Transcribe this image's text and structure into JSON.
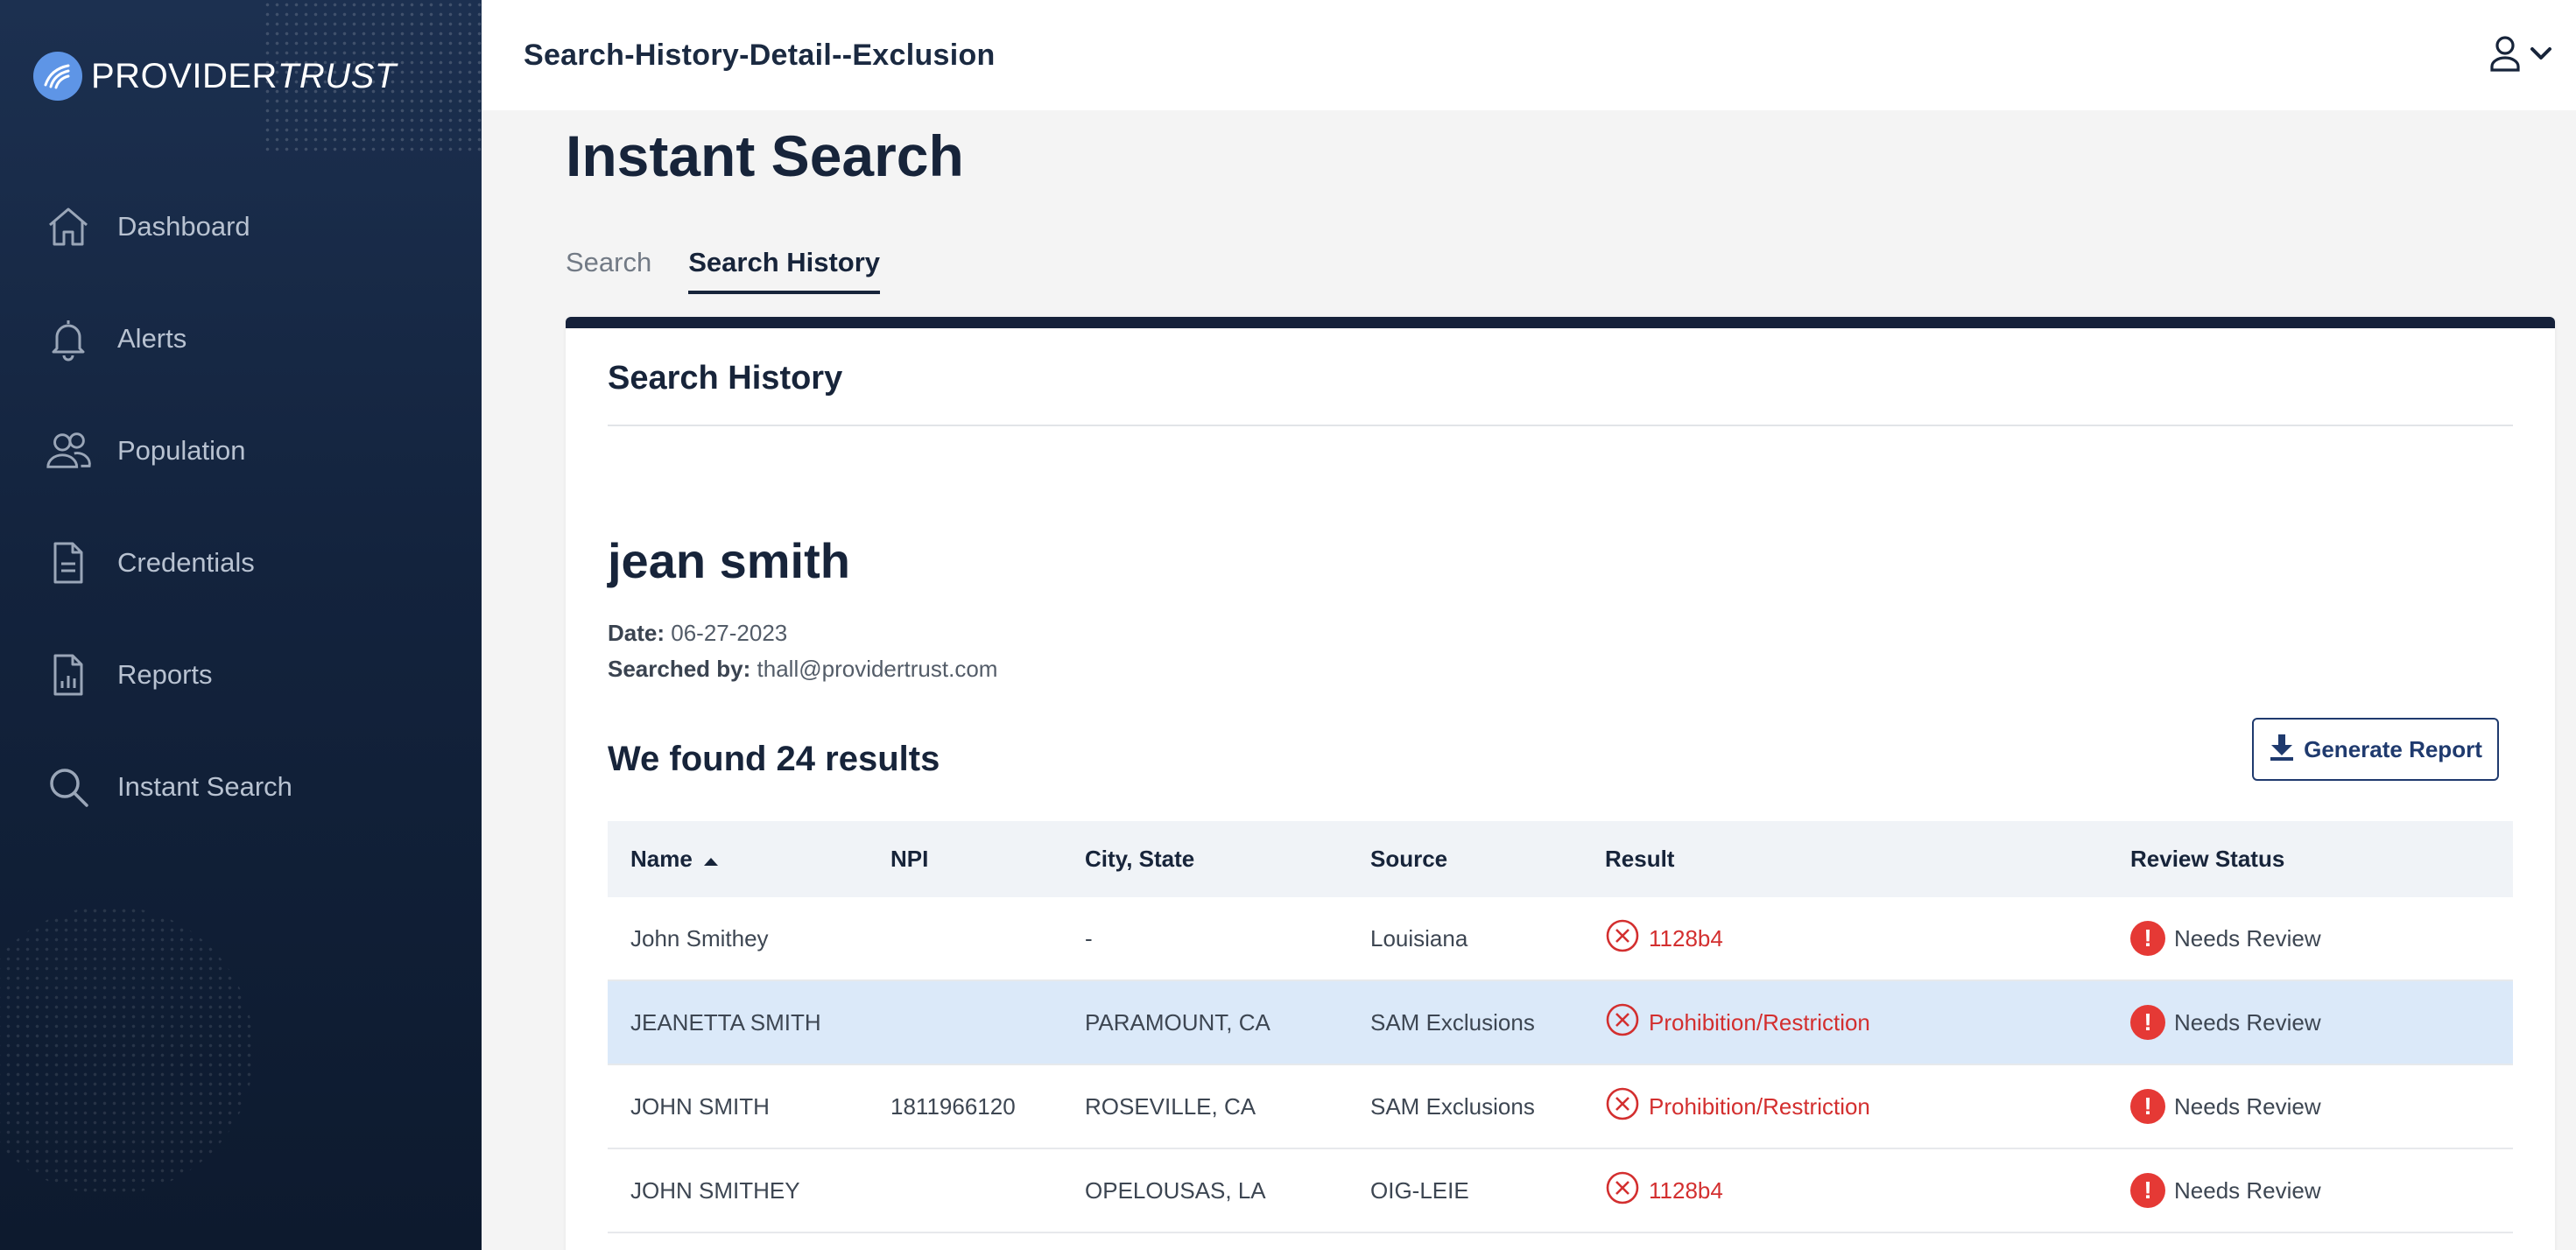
{
  "app": {
    "brand_primary": "PROVIDER",
    "brand_secondary": "TRUST",
    "window_title": "Search-History-Detail--Exclusion"
  },
  "sidebar": {
    "items": [
      {
        "label": "Dashboard",
        "icon": "home-icon"
      },
      {
        "label": "Alerts",
        "icon": "bell-icon"
      },
      {
        "label": "Population",
        "icon": "users-icon"
      },
      {
        "label": "Credentials",
        "icon": "document-icon"
      },
      {
        "label": "Reports",
        "icon": "report-icon"
      },
      {
        "label": "Instant Search",
        "icon": "search-icon"
      }
    ]
  },
  "main": {
    "title": "Instant Search",
    "tabs": [
      {
        "label": "Search",
        "active": false
      },
      {
        "label": "Search History",
        "active": true
      }
    ]
  },
  "card": {
    "title": "Search History",
    "person_name": "jean smith",
    "date_label": "Date:",
    "date_value": "06-27-2023",
    "searched_by_label": "Searched by:",
    "searched_by_value": "thall@providertrust.com",
    "results_count": "We found 24 results",
    "generate_report_label": "Generate Report"
  },
  "table": {
    "columns": [
      "Name",
      "NPI",
      "City, State",
      "Source",
      "Result",
      "Review Status"
    ],
    "sorted_column": "Name",
    "sort_direction": "ascending",
    "rows": [
      {
        "name": "John Smithey",
        "npi": "",
        "city": "-",
        "source": "Louisiana",
        "result": "1128b4",
        "review": "Needs Review",
        "highlight": false
      },
      {
        "name": "JEANETTA SMITH",
        "npi": "",
        "city": "PARAMOUNT, CA",
        "source": "SAM Exclusions",
        "result": "Prohibition/Restriction",
        "review": "Needs Review",
        "highlight": true
      },
      {
        "name": "JOHN SMITH",
        "npi": "1811966120",
        "city": "ROSEVILLE, CA",
        "source": "SAM Exclusions",
        "result": "Prohibition/Restriction",
        "review": "Needs Review",
        "highlight": false
      },
      {
        "name": "JOHN SMITHEY",
        "npi": "",
        "city": "OPELOUSAS, LA",
        "source": "OIG-LEIE",
        "result": "1128b4",
        "review": "Needs Review",
        "highlight": false
      }
    ]
  },
  "colors": {
    "sidebar_bg": "#13233d",
    "accent_navy": "#15213a",
    "result_red": "#d32f2f",
    "highlight_row": "#dbe9f9",
    "brand_blue": "#5e95e6"
  }
}
